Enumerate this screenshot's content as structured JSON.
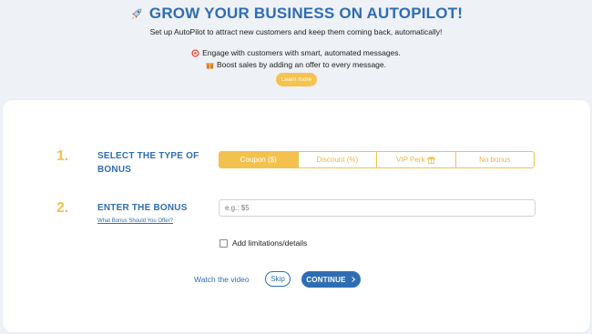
{
  "hero": {
    "title": "GROW YOUR BUSINESS ON AUTOPILOT!",
    "subtitle": "Set up AutoPilot to attract new customers and keep them coming back, automatically!",
    "bullets": [
      {
        "icon": "target-icon",
        "text": "Engage with customers with smart, automated messages."
      },
      {
        "icon": "gift-icon",
        "text": "Boost sales by adding an offer to every message."
      }
    ],
    "learn_more": "Learn more"
  },
  "steps": [
    {
      "number": "1.",
      "label_line1": "SELECT THE TYPE OF",
      "label_line2": "BONUS"
    },
    {
      "number": "2.",
      "label": "ENTER THE BONUS",
      "help_link": "What Bonus Should You Offer?"
    }
  ],
  "bonus_types": {
    "options": [
      "Coupon ($)",
      "Discount (%)",
      "VIP Perk",
      "No bonus"
    ],
    "selected": "Coupon ($)"
  },
  "bonus_input": {
    "placeholder": "e.g.: $5",
    "value": ""
  },
  "limitations_checkbox": {
    "label": "Add limitations/details",
    "checked": false
  },
  "footer": {
    "watch_video": "Watch the video",
    "skip": "Skip",
    "continue": "CONTINUE"
  },
  "colors": {
    "primary_blue": "#2f6db3",
    "accent_yellow": "#f2c14e",
    "background": "#eef1f5"
  }
}
